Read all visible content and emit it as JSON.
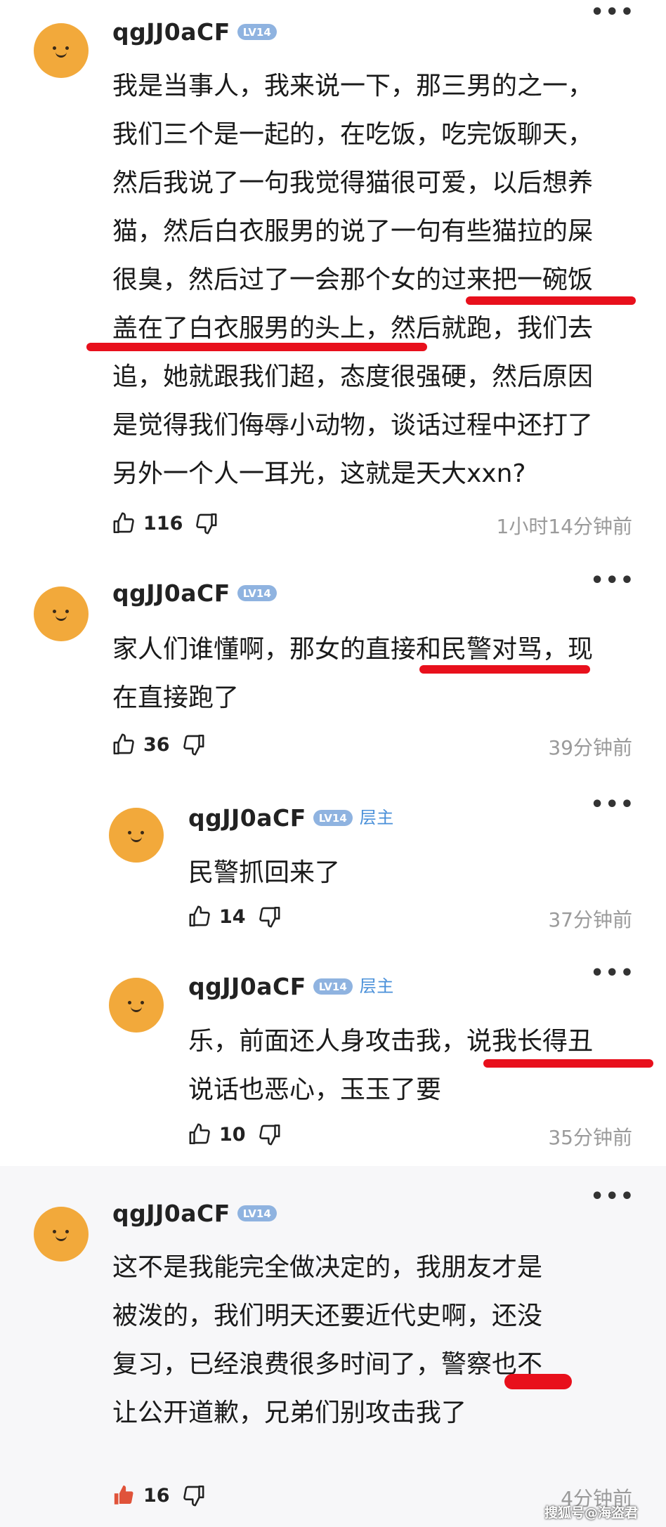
{
  "comments": [
    {
      "username": "qgJJ0aCF",
      "level": "LV14",
      "lines": [
        "我是当事人，我来说一下，那三男的之一，",
        "我们三个是一起的，在吃饭，吃完饭聊天，",
        "然后我说了一句我觉得猫很可爱，以后想养",
        "猫，然后白衣服男的说了一句有些猫拉的屎",
        "很臭，然后过了一会那个女的过来把一碗饭",
        "盖在了白衣服男的头上，然后就跑，我们去",
        "追，她就跟我们超，态度很强硬，然后原因",
        "是觉得我们侮辱小动物，谈话过程中还打了",
        "另外一个人一耳光，这就是天大xxn?"
      ],
      "likes": "116",
      "time": "1小时14分钟前"
    },
    {
      "username": "qgJJ0aCF",
      "level": "LV14",
      "lines": [
        "家人们谁懂啊，那女的直接和民警对骂，现",
        "在直接跑了"
      ],
      "likes": "36",
      "time": "39分钟前"
    },
    {
      "username": "qgJJ0aCF",
      "level": "LV14",
      "badge": "层主",
      "lines": [
        "民警抓回来了"
      ],
      "likes": "14",
      "time": "37分钟前"
    },
    {
      "username": "qgJJ0aCF",
      "level": "LV14",
      "badge": "层主",
      "lines": [
        "乐，前面还人身攻击我，说我长得丑",
        "说话也恶心，玉玉了要"
      ],
      "likes": "10",
      "time": "35分钟前"
    },
    {
      "username": "qgJJ0aCF",
      "level": "LV14",
      "lines": [
        "这不是我能完全做决定的，我朋友才是",
        "被泼的，我们明天还要近代史啊，还没",
        "复习，已经浪费很多时间了，警察也不",
        "让公开道歉，兄弟们别攻击我了"
      ],
      "likes": "16",
      "time": "4分钟前"
    }
  ],
  "watermark": "搜狐号@海盗君",
  "icons": {
    "like": "thumbs-up-icon",
    "dislike": "thumbs-down-icon",
    "more": "more-dots-icon"
  },
  "colors": {
    "highlight": "#e8101c",
    "level_badge": "#8fb3e0",
    "owner_badge": "#4a90d9",
    "liked": "#e0533a"
  }
}
